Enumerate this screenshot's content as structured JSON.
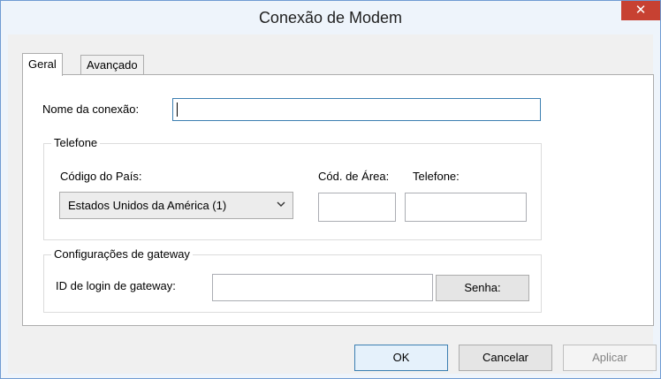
{
  "window": {
    "title": "Conexão de Modem",
    "close_label": "✕"
  },
  "tabs": [
    {
      "label": "Geral",
      "active": true
    },
    {
      "label": "Avançado",
      "active": false
    }
  ],
  "general": {
    "connection_name": {
      "label": "Nome da conexão:",
      "value": ""
    },
    "phone_group": {
      "title": "Telefone",
      "country_label": "Código do País:",
      "country_value": "Estados Unidos da América (1)",
      "area_code_label": "Cód. de Área:",
      "area_code_value": "",
      "phone_label": "Telefone:",
      "phone_value": ""
    },
    "gateway_group": {
      "title": "Configurações de gateway",
      "login_label": "ID de login de gateway:",
      "login_value": "",
      "password_button": "Senha:"
    }
  },
  "footer": {
    "ok": "OK",
    "cancel": "Cancelar",
    "apply": "Aplicar",
    "apply_enabled": false
  },
  "colors": {
    "title_bar": "#eef4fb",
    "close_button": "#c74132",
    "focus_border": "#3c7fb1"
  }
}
